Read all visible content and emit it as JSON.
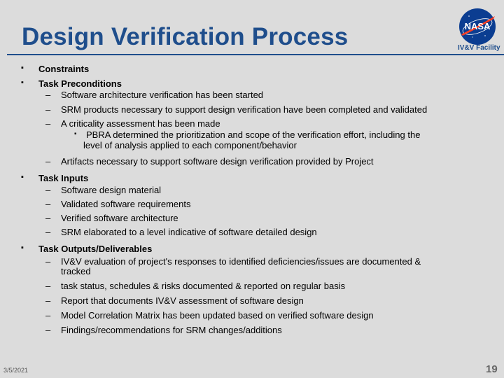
{
  "slide": {
    "title": "Design Verification Process",
    "logo": {
      "icon": "nasa-meatball-logo",
      "wordmark": "NASA",
      "caption": "IV&V Facility"
    },
    "bullets": [
      {
        "label": "Constraints",
        "children": []
      },
      {
        "label": "Task Preconditions",
        "children": [
          {
            "text": "Software architecture verification has been started"
          },
          {
            "text": "SRM products necessary to support design verification have been completed and validated"
          },
          {
            "text": "A criticality assessment has been made",
            "children": [
              {
                "line1": "PBRA determined the prioritization and scope of the verification effort, including the",
                "line2": "level of analysis applied to each component/behavior"
              }
            ]
          },
          {
            "text": "Artifacts necessary to support software design verification provided by Project"
          }
        ]
      },
      {
        "label": "Task Inputs",
        "children": [
          {
            "text": "Software design material"
          },
          {
            "text": "Validated software requirements"
          },
          {
            "text": "Verified software architecture"
          },
          {
            "text": "SRM elaborated to a level indicative of software detailed design"
          }
        ]
      },
      {
        "label": "Task Outputs/Deliverables",
        "children": [
          {
            "text": "IV&V evaluation of project's responses to identified deficiencies/issues are documented &",
            "text2": "tracked"
          },
          {
            "text": "task status, schedules & risks documented & reported on regular basis"
          },
          {
            "text": "Report that documents IV&V assessment of software design"
          },
          {
            "text": "Model Correlation Matrix has been updated based on verified software design"
          },
          {
            "text": "Findings/recommendations for SRM changes/additions"
          }
        ]
      }
    ],
    "bullet_glyph": "▪",
    "dash_glyph": "–",
    "footer": {
      "date": "3/5/2021",
      "page_number": "19"
    }
  }
}
